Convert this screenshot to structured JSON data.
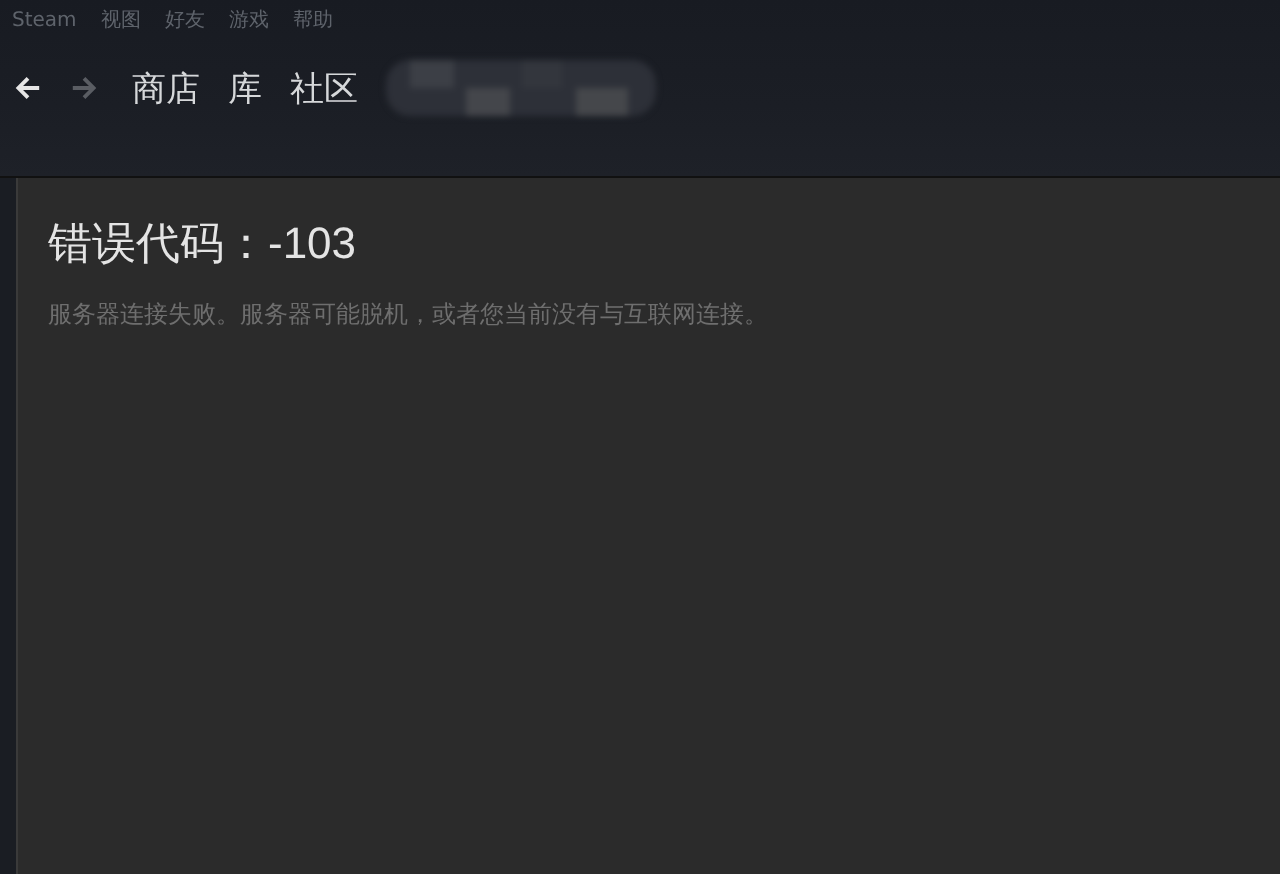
{
  "menu_bar": {
    "items": [
      "Steam",
      "视图",
      "好友",
      "游戏",
      "帮助"
    ]
  },
  "nav_buttons": [
    {
      "kind": "back",
      "disabled": false
    },
    {
      "kind": "forward",
      "disabled": true
    }
  ],
  "nav_tabs": [
    "商店",
    "库",
    "社区"
  ],
  "account_name": {
    "redacted": true
  },
  "error": {
    "title": "错误代码：-103",
    "message": "服务器连接失败。服务器可能脱机，或者您当前没有与互联网连接。"
  }
}
